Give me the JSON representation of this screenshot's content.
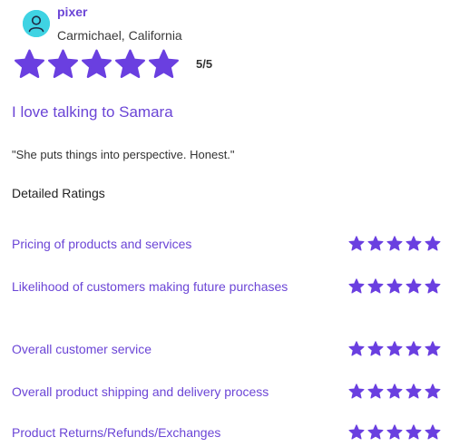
{
  "reviewer": {
    "name": "pixer",
    "location": "Carmichael, California",
    "avatar_icon": "user-icon"
  },
  "overall": {
    "stars": 5,
    "max": 5,
    "score_text": "5/5"
  },
  "review": {
    "title": "I love talking to Samara",
    "quote": "\"She puts things into perspective. Honest.\""
  },
  "detailed": {
    "heading": "Detailed Ratings",
    "items": [
      {
        "label": "Pricing of products and services",
        "stars": 5
      },
      {
        "label": "Likelihood of customers making future purchases",
        "stars": 5
      },
      {
        "label": "Overall customer service",
        "stars": 5
      },
      {
        "label": "Overall product shipping and delivery process",
        "stars": 5
      },
      {
        "label": "Product Returns/Refunds/Exchanges",
        "stars": 5
      }
    ]
  },
  "colors": {
    "accent": "#6b45d6",
    "star": "#6a3fe0",
    "avatar_bg": "#3fd3e3"
  }
}
